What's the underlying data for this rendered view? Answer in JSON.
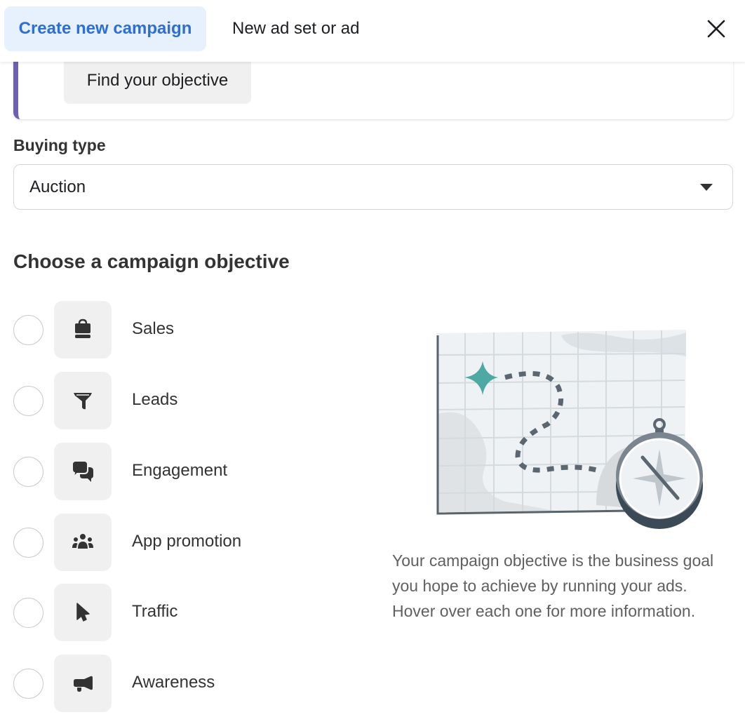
{
  "header": {
    "tabs": [
      {
        "label": "Create new campaign",
        "active": true
      },
      {
        "label": "New ad set or ad",
        "active": false
      }
    ],
    "close_icon": "close-icon"
  },
  "info_card": {
    "find_objective_label": "Find your objective",
    "accent_color": "#6e5fb5"
  },
  "buying_type": {
    "label": "Buying type",
    "selected": "Auction"
  },
  "objective": {
    "title": "Choose a campaign objective",
    "options": [
      {
        "label": "Sales",
        "icon": "shopping-bag-icon",
        "selected": false
      },
      {
        "label": "Leads",
        "icon": "funnel-icon",
        "selected": false
      },
      {
        "label": "Engagement",
        "icon": "chat-bubbles-icon",
        "selected": false
      },
      {
        "label": "App promotion",
        "icon": "people-group-icon",
        "selected": false
      },
      {
        "label": "Traffic",
        "icon": "cursor-icon",
        "selected": false
      },
      {
        "label": "Awareness",
        "icon": "megaphone-icon",
        "selected": false
      }
    ],
    "description": "Your campaign objective is the business goal you hope to achieve by running your ads. Hover over each one for more information."
  },
  "colors": {
    "active_tab_bg": "#e7f0fd",
    "active_tab_text": "#2d6fd6",
    "illustration_star": "#4ea8a4",
    "illustration_dark": "#3b4a56"
  }
}
